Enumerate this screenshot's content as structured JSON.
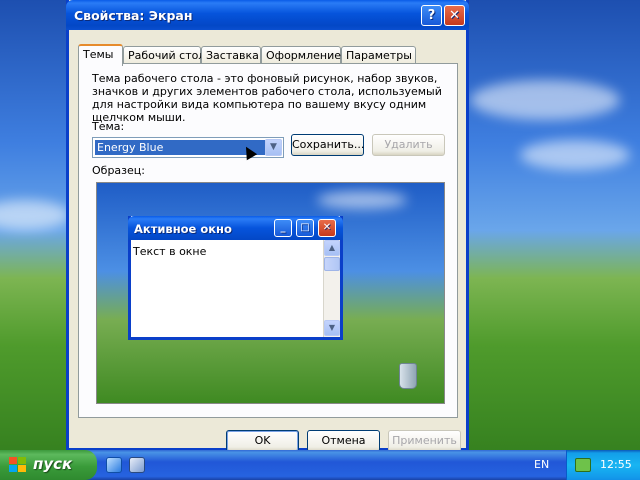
{
  "dialog": {
    "title": "Свойства: Экран",
    "help_glyph": "?",
    "close_glyph": "✕",
    "tabs": [
      {
        "label": "Темы",
        "active": true
      },
      {
        "label": "Рабочий стол",
        "active": false
      },
      {
        "label": "Заставка",
        "active": false
      },
      {
        "label": "Оформление",
        "active": false
      },
      {
        "label": "Параметры",
        "active": false
      }
    ],
    "description": "Тема рабочего стола - это фоновый рисунок, набор звуков, значков и других элементов рабочего стола, используемый для настройки вида компьютера по вашему вкусу одним щелчком мыши.",
    "theme_label": "Тема:",
    "theme_value": "Energy Blue",
    "save_label": "Сохранить...",
    "delete_label": "Удалить",
    "sample_label": "Образец:",
    "preview": {
      "window_title": "Активное окно",
      "window_text": "Текст в окне",
      "min_glyph": "_",
      "max_glyph": "□",
      "close_glyph": "✕"
    },
    "ok_label": "OK",
    "cancel_label": "Отмена",
    "apply_label": "Применить"
  },
  "taskbar": {
    "start_label": "пуск",
    "language": "EN",
    "clock": "12:55"
  },
  "icons": {
    "combo_arrow": "▼",
    "scroll_up": "▲",
    "scroll_down": "▼"
  },
  "colors": {
    "titlebar": "#0654dc",
    "dialog_bg": "#ece9d8",
    "selection": "#316ac5",
    "start_button": "#3a9b3a",
    "taskbar": "#2157d7",
    "tab_active_accent": "#e68b2c"
  }
}
